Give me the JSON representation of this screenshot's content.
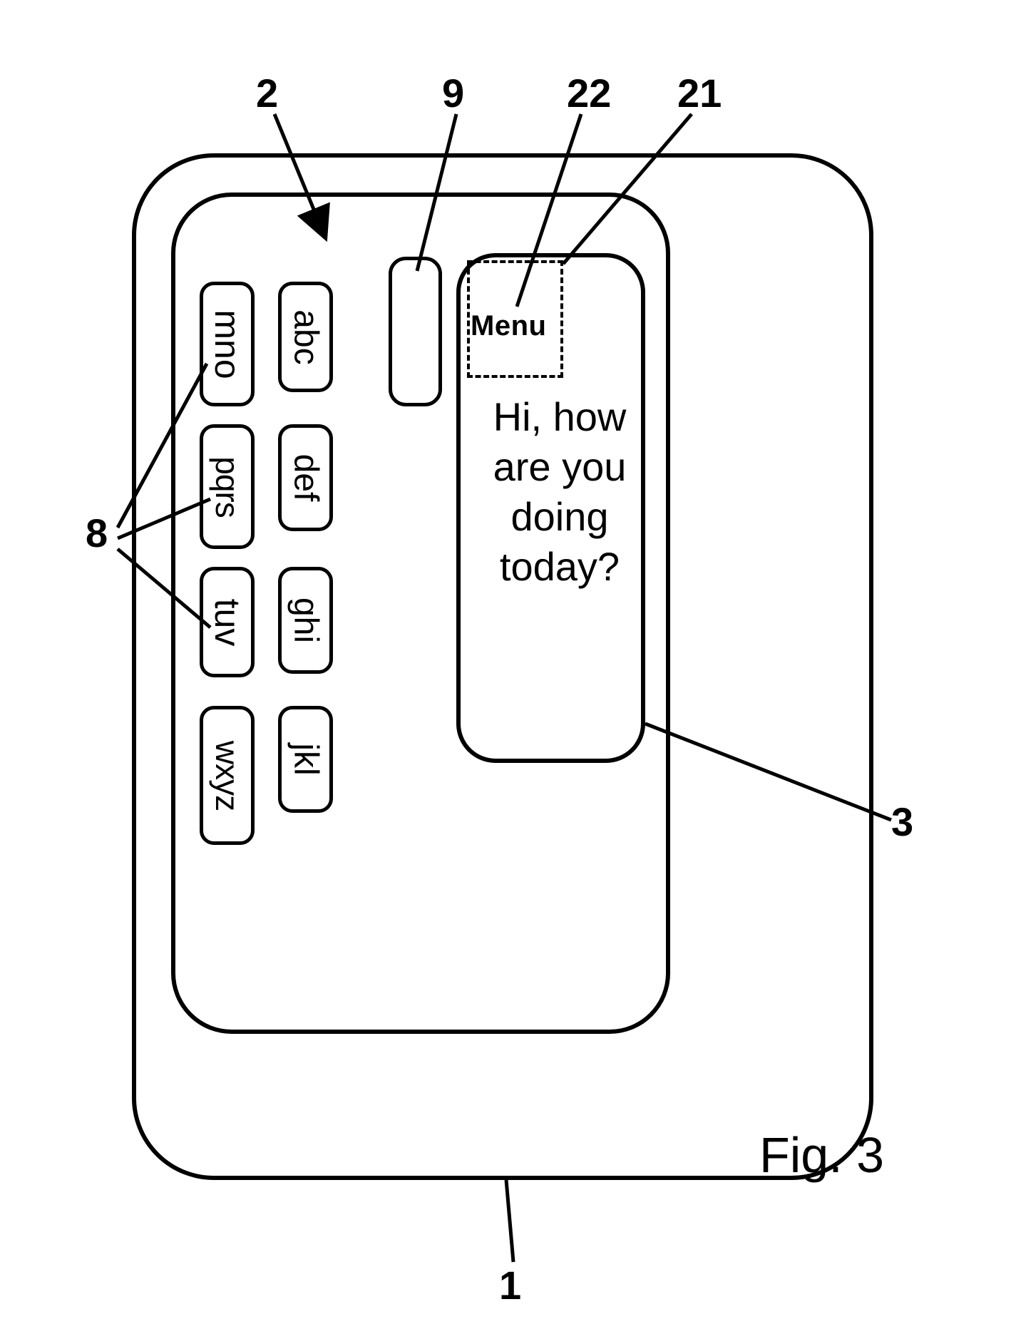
{
  "figure_label": "Fig. 3",
  "refs": {
    "r1": "1",
    "r2": "2",
    "r3": "3",
    "r8": "8",
    "r9": "9",
    "r21": "21",
    "r22": "22"
  },
  "screen": {
    "menu_label": "Menu",
    "message": "Hi, how are you doing today?"
  },
  "keys": {
    "abc": "abc",
    "def": "def",
    "ghi": "ghi",
    "jkl": "jkl",
    "mno": "mno",
    "pqrs": "pqrs",
    "tuv": "tuv",
    "wxyz": "wxyz"
  }
}
